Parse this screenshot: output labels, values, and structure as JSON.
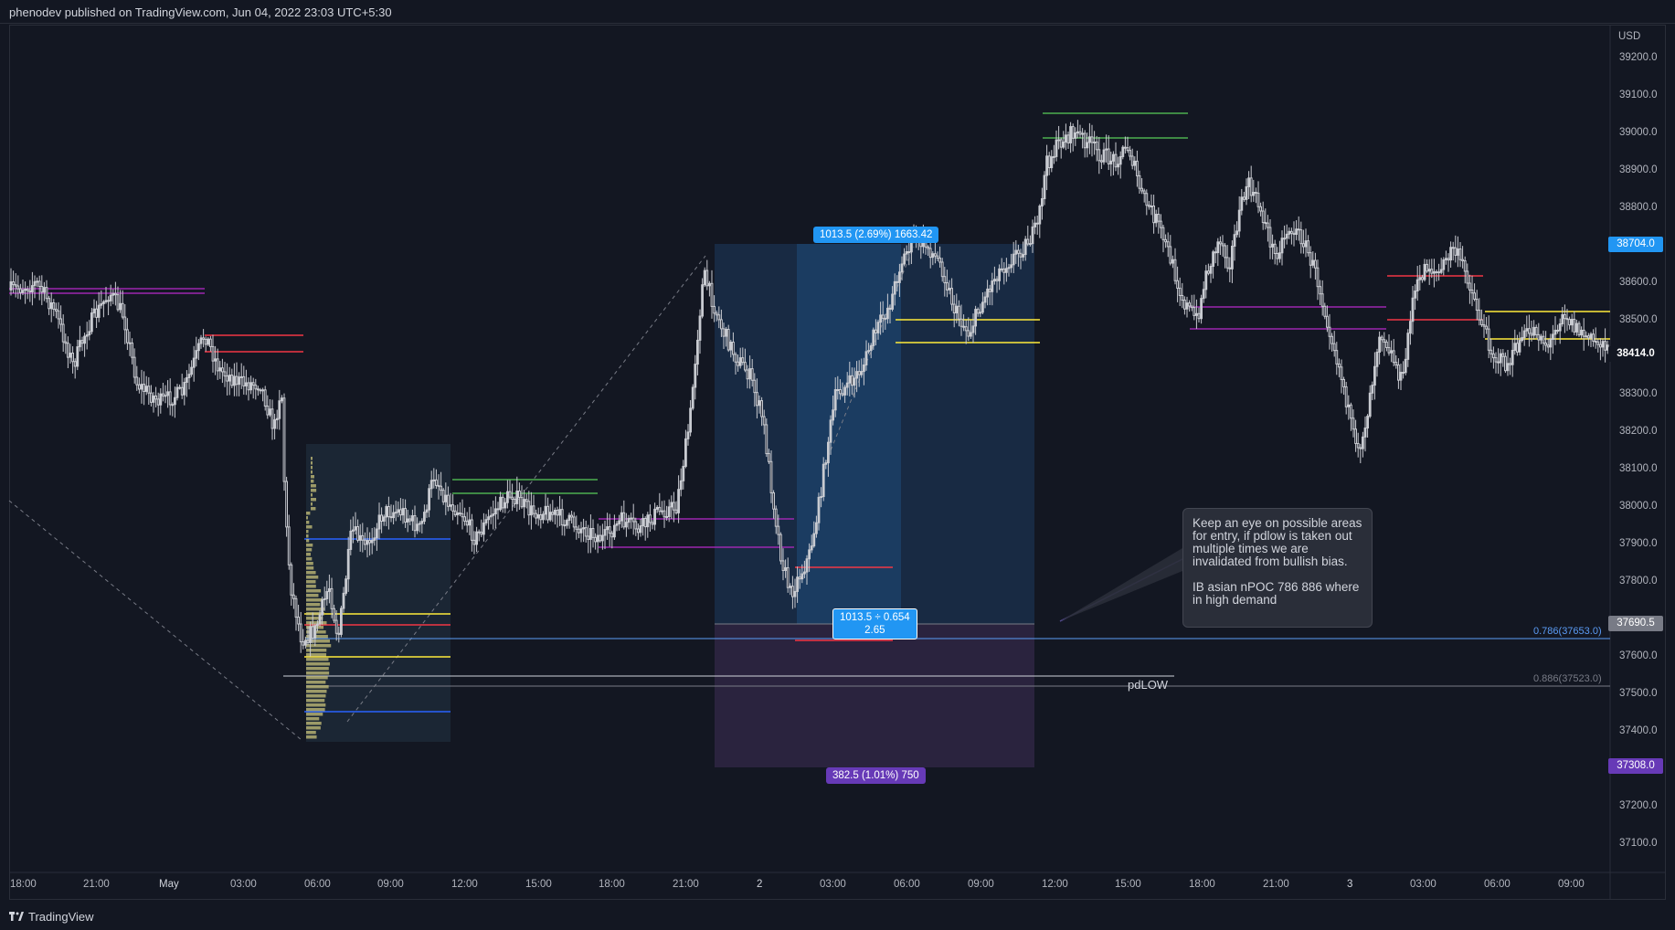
{
  "header": {
    "published_text": "phenodev published on TradingView.com, Jun 04, 2022 23:03 UTC+5:30"
  },
  "footer": {
    "brand": "TradingView",
    "logo_icon": "tradingview-logo-icon"
  },
  "price_axis": {
    "currency": "USD",
    "ticks": [
      "39200.0",
      "39100.0",
      "39000.0",
      "38900.0",
      "38800.0",
      "38600.0",
      "38500.0",
      "38300.0",
      "38200.0",
      "38100.0",
      "38000.0",
      "37900.0",
      "37800.0",
      "37600.0",
      "37500.0",
      "37400.0",
      "37200.0",
      "37100.0"
    ],
    "badges": {
      "top_target": "38704.0",
      "last_price": "38414.0",
      "entry": "37690.5",
      "stop": "37308.0"
    }
  },
  "time_axis": {
    "ticks": [
      "18:00",
      "21:00",
      "May",
      "03:00",
      "06:00",
      "09:00",
      "12:00",
      "15:00",
      "18:00",
      "21:00",
      "2",
      "03:00",
      "06:00",
      "09:00",
      "12:00",
      "15:00",
      "18:00",
      "21:00",
      "3",
      "03:00",
      "06:00",
      "09:00"
    ]
  },
  "position_tool": {
    "target_label": "1013.5 (2.69%) 1663.42",
    "ratio_label_line1": "1013.5 ÷ 0.654",
    "ratio_label_line2": "2.65",
    "stop_label": "382.5 (1.01%) 750"
  },
  "fib_levels": [
    {
      "label": "0.786(37653.0)",
      "color": "#5b9cf6"
    },
    {
      "label": "0.886(37523.0)",
      "color": "#787b86"
    }
  ],
  "annotations": {
    "pdlow": "pdLOW",
    "note_line1": "Keep an eye on possible areas for entry, if pdlow is taken out multiple times we are invalidated from bullish bias.",
    "note_line2": "IB asian nPOC 786 886 where in high demand"
  },
  "colors": {
    "background": "#131722",
    "candle": "#c9cbd1",
    "green": "#4caf50",
    "red": "#f23645",
    "yellow": "#ffeb3b",
    "purple": "#9c27b0",
    "blue": "#2962ff",
    "target_zone": "#1e3a5f",
    "stop_zone": "#2b2440"
  }
}
